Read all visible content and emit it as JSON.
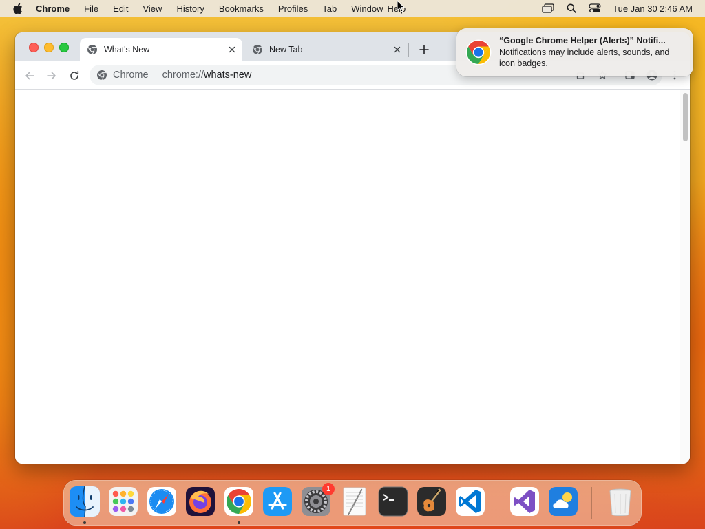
{
  "menubar": {
    "app_name": "Chrome",
    "items": [
      "File",
      "Edit",
      "View",
      "History",
      "Bookmarks",
      "Profiles",
      "Tab",
      "Window",
      "Help"
    ],
    "clock": "Tue Jan 30  2:46 AM"
  },
  "browser": {
    "tabs": [
      {
        "label": "What's New",
        "active": true
      },
      {
        "label": "New Tab",
        "active": false
      }
    ],
    "omnibox": {
      "chip_label": "Chrome",
      "url_scheme": "chrome://",
      "url_host": "whats-new"
    }
  },
  "notification": {
    "title": "“Google Chrome Helper (Alerts)” Notifi...",
    "body": "Notifications may include alerts, sounds, and icon badges."
  },
  "dock": {
    "items": [
      {
        "name": "finder",
        "running": true
      },
      {
        "name": "launchpad",
        "running": false
      },
      {
        "name": "safari",
        "running": false
      },
      {
        "name": "firefox",
        "running": false
      },
      {
        "name": "chrome",
        "running": true
      },
      {
        "name": "app-store",
        "running": false
      },
      {
        "name": "system-settings",
        "running": false,
        "badge": "1"
      },
      {
        "name": "textedit",
        "running": false
      },
      {
        "name": "terminal",
        "running": false
      },
      {
        "name": "garageband",
        "running": false
      },
      {
        "name": "vscode",
        "running": false
      },
      {
        "name": "visual-studio",
        "running": false
      },
      {
        "name": "weather",
        "running": false
      },
      {
        "name": "trash",
        "running": false
      }
    ]
  },
  "colors": {
    "accent_blue": "#1a73e8",
    "chrome_red": "#ea4335",
    "chrome_yellow": "#fbbc04",
    "chrome_green": "#34a853"
  }
}
